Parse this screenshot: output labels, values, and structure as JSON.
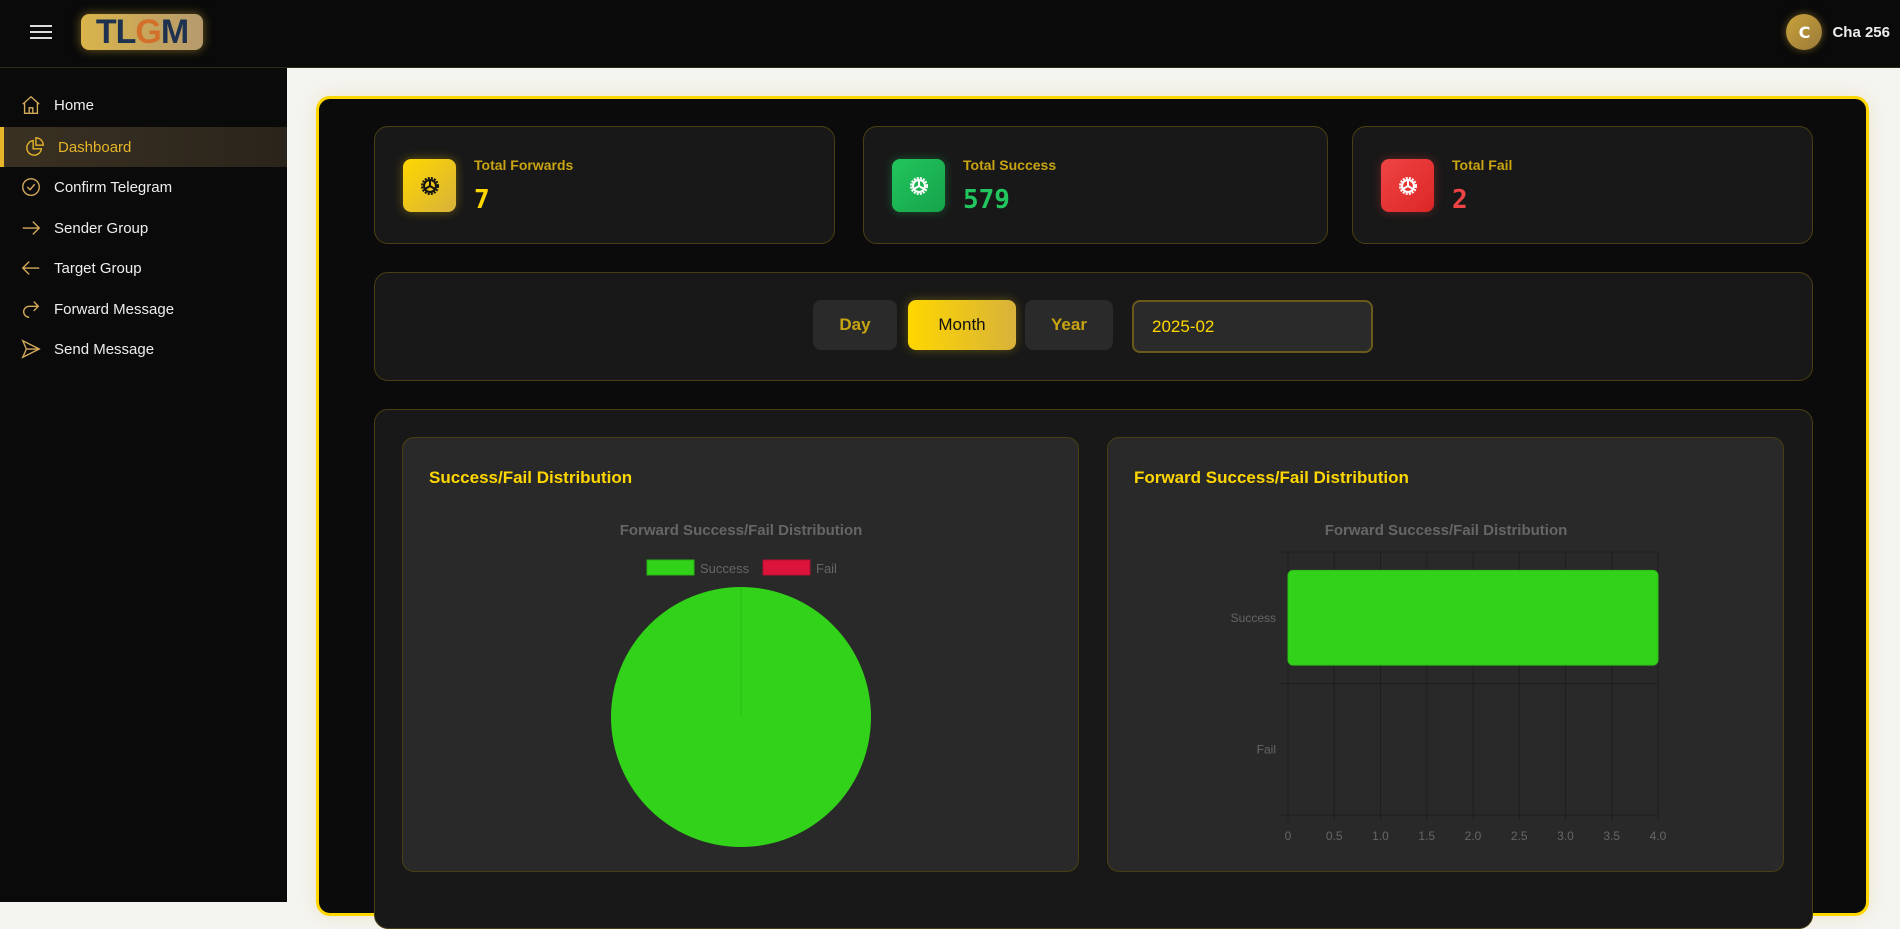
{
  "header": {
    "logo": "TLGM",
    "user_initial": "C",
    "user_name": "Cha 256"
  },
  "sidebar": {
    "items": [
      {
        "label": "Home",
        "icon": "home-icon"
      },
      {
        "label": "Dashboard",
        "icon": "pie-chart-icon",
        "active": true
      },
      {
        "label": "Confirm Telegram",
        "icon": "badge-check-icon"
      },
      {
        "label": "Sender Group",
        "icon": "arrow-right-icon"
      },
      {
        "label": "Target Group",
        "icon": "arrow-left-icon"
      },
      {
        "label": "Forward Message",
        "icon": "forward-icon"
      },
      {
        "label": "Send Message",
        "icon": "send-icon"
      }
    ]
  },
  "stats": [
    {
      "title": "Total Forwards",
      "value": "7",
      "color": "#ffd700"
    },
    {
      "title": "Total Success",
      "value": "579",
      "color": "#22c55e"
    },
    {
      "title": "Total Fail",
      "value": "2",
      "color": "#ef4444"
    }
  ],
  "filter": {
    "day": "Day",
    "month": "Month",
    "year": "Year",
    "selected": "Month",
    "date_value": "2025-02"
  },
  "cards": {
    "left_title": "Success/Fail Distribution",
    "right_title": "Forward Success/Fail Distribution"
  },
  "chart_data": [
    {
      "type": "pie",
      "title": "Forward Success/Fail Distribution",
      "legend": [
        "Success",
        "Fail"
      ],
      "legend_position": "top",
      "categories": [
        "Success",
        "Fail"
      ],
      "values": [
        4,
        0
      ],
      "colors": [
        "#32d21a",
        "#dc143c"
      ]
    },
    {
      "type": "bar",
      "orientation": "horizontal",
      "title": "Forward Success/Fail Distribution",
      "categories": [
        "Success",
        "Fail"
      ],
      "values": [
        4,
        0
      ],
      "xlim": [
        0,
        4
      ],
      "xticks": [
        "0",
        "0.5",
        "1.0",
        "1.5",
        "2.0",
        "2.5",
        "3.0",
        "3.5",
        "4.0"
      ],
      "grid": true,
      "color": "#32d21a"
    }
  ]
}
